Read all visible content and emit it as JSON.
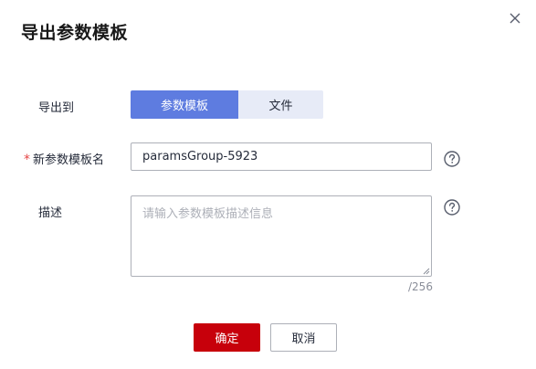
{
  "dialog": {
    "title": "导出参数模板",
    "close_icon": "close-icon"
  },
  "form": {
    "export_to_label": "导出到",
    "export_options": [
      "参数模板",
      "文件"
    ],
    "selected_export": "参数模板",
    "template_name_label": "新参数模板名",
    "required_mark": "*",
    "template_name_value": "paramsGroup-5923",
    "description_label": "描述",
    "description_placeholder": "请输入参数模板描述信息",
    "description_counter": "/256",
    "help_icon": "question-circle-icon"
  },
  "footer": {
    "confirm_label": "确定",
    "cancel_label": "取消"
  },
  "colors": {
    "accent": "#5e7ce0",
    "primary_button": "#c7000b",
    "required": "#e54545"
  }
}
